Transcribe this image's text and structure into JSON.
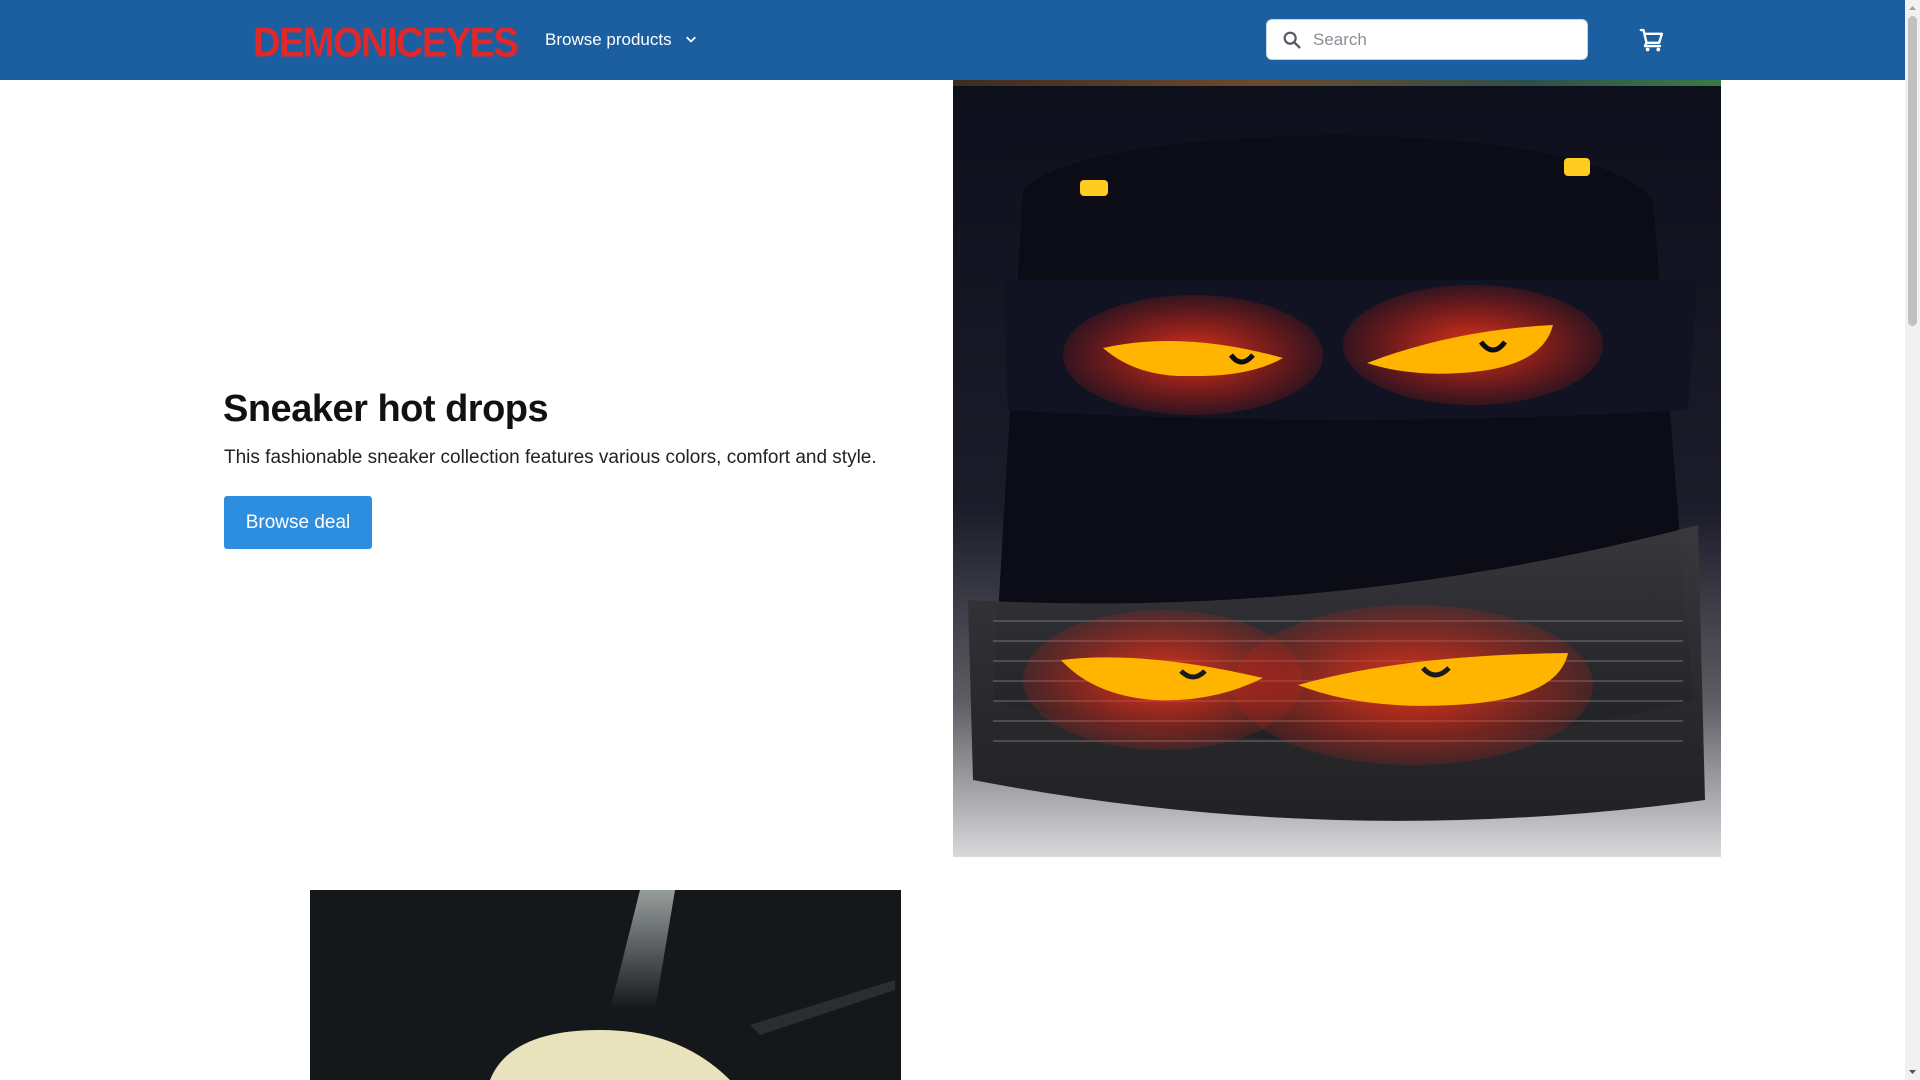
{
  "header": {
    "logo_text": "DEMONICEYES",
    "browse_products_label": "Browse products",
    "search_placeholder": "Search"
  },
  "hero": {
    "title": "Sneaker hot drops",
    "subtitle": "This fashionable sneaker collection features various colors, comfort and style.",
    "cta_label": "Browse deal"
  },
  "icons": {
    "search": "search-icon",
    "cart": "cart-icon",
    "chevron": "chevron-down-icon"
  },
  "colors": {
    "header_bg": "#1b5fa0",
    "logo": "#e0282a",
    "cta_bg": "#2d8ee0",
    "text": "#111111"
  }
}
